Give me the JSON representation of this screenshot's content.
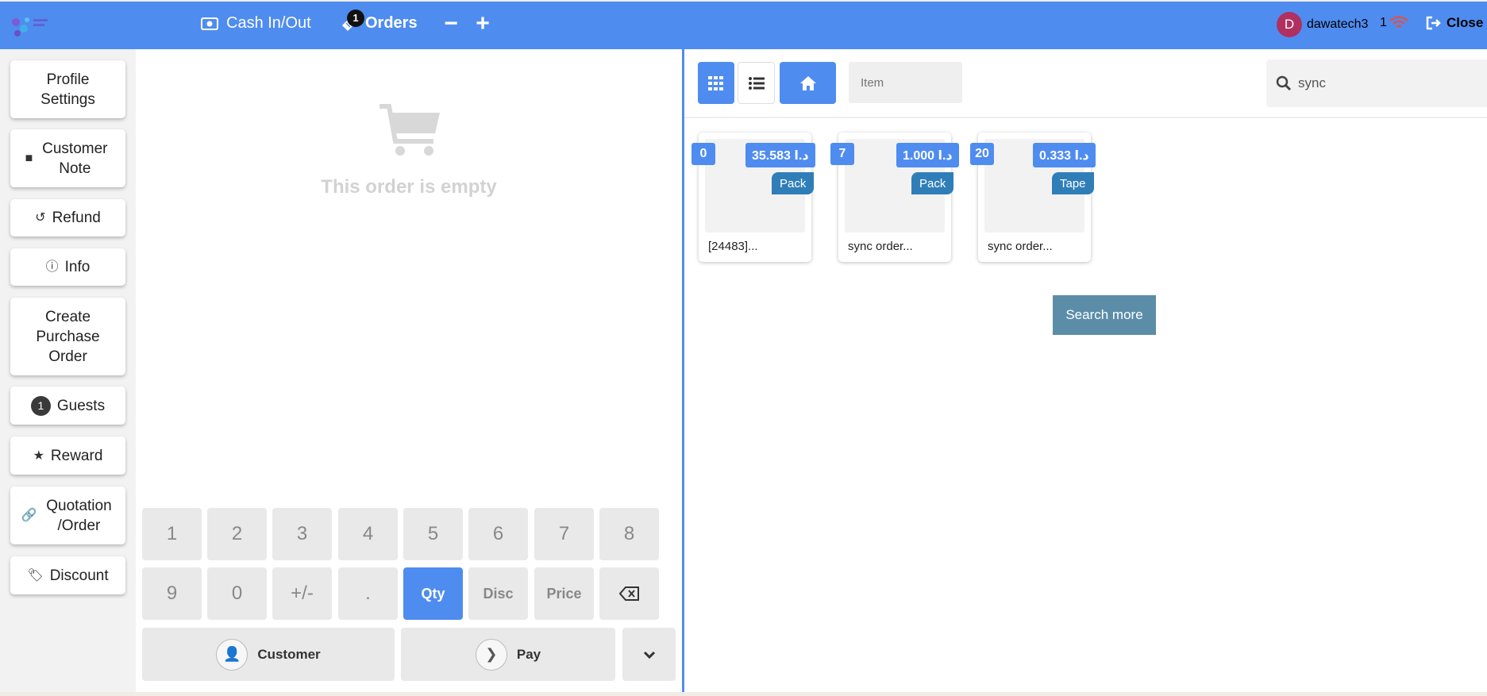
{
  "topbar": {
    "cash_label": "Cash In/Out",
    "orders_label": "Orders",
    "orders_count": "1",
    "minus_label": "−",
    "plus_label": "+",
    "user_initial": "D",
    "user_name": "dawatech3",
    "sync_count": "1",
    "close_label": "Close",
    "brand_color": "#4f8cf0"
  },
  "sidebar": {
    "profile_settings": "Profile Settings",
    "customer_note": "Customer Note",
    "refund": "Refund",
    "info": "Info",
    "create_po": "Create Purchase Order",
    "guests_count": "1",
    "guests": "Guests",
    "reward": "Reward",
    "quotation": "Quotation /Order",
    "discount": "Discount"
  },
  "order": {
    "empty_text": "This order is empty"
  },
  "numpad": {
    "k1": "1",
    "k2": "2",
    "k3": "3",
    "k4": "4",
    "k5": "5",
    "k6": "6",
    "k7": "7",
    "k8": "8",
    "k9": "9",
    "k0": "0",
    "plusminus": "+/-",
    "dot": ".",
    "qty": "Qty",
    "disc": "Disc",
    "price": "Price",
    "customer": "Customer",
    "pay": "Pay"
  },
  "products": {
    "item_placeholder": "Item",
    "search_value": "sync",
    "search_more": "Search more",
    "cards": [
      {
        "qty": "0",
        "price": "35.583 د.ا",
        "unit": "Pack",
        "name": "[24483]..."
      },
      {
        "qty": "7",
        "price": "1.000 د.ا",
        "unit": "Pack",
        "name": "sync order..."
      },
      {
        "qty": "20",
        "price": "0.333 د.ا",
        "unit": "Tape",
        "name": "sync order..."
      }
    ]
  }
}
